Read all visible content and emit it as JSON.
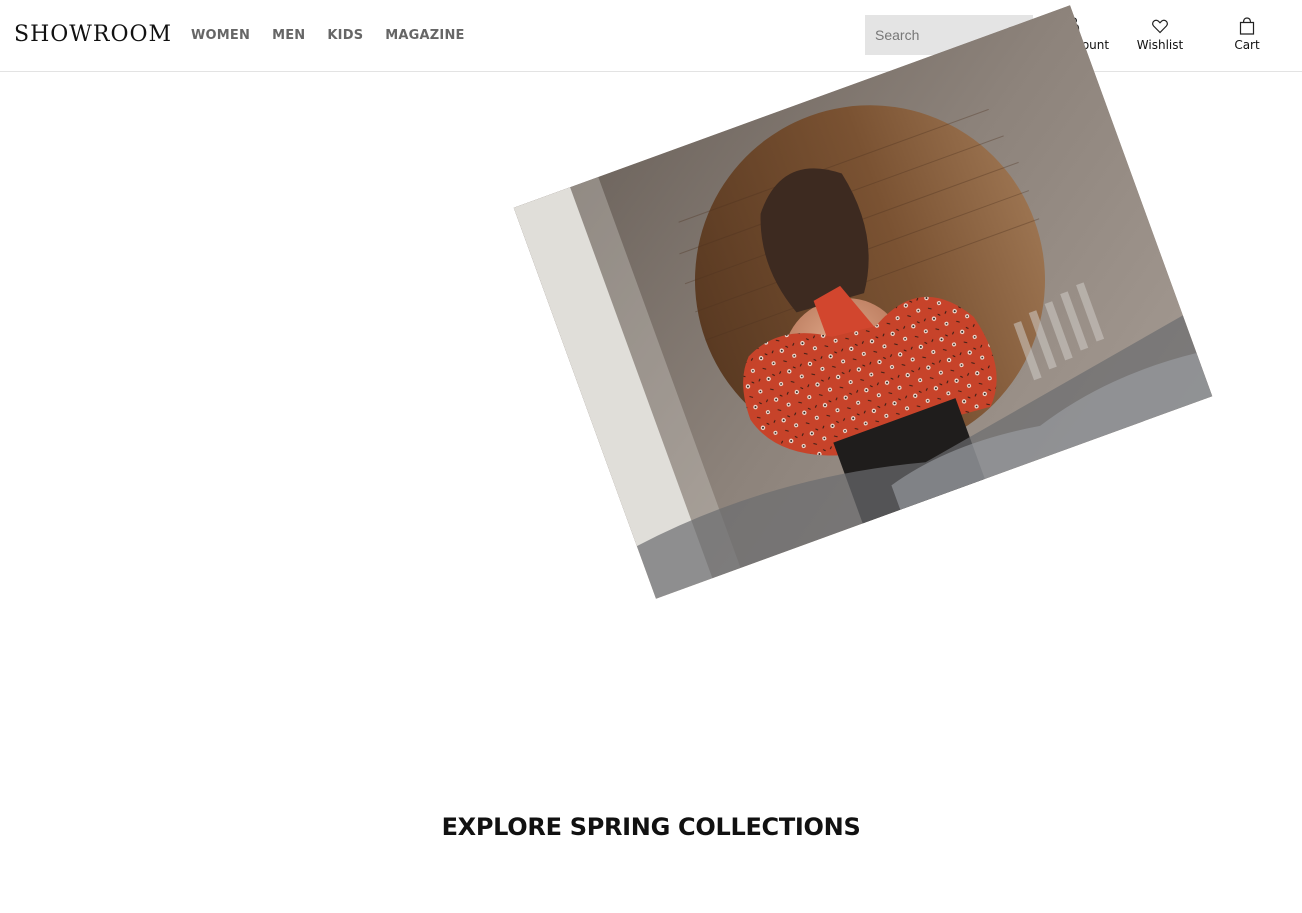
{
  "brand": {
    "logo_text": "SHOWROOM"
  },
  "nav": {
    "items": [
      {
        "label": "WOMEN"
      },
      {
        "label": "MEN"
      },
      {
        "label": "KIDS"
      },
      {
        "label": "MAGAZINE"
      }
    ]
  },
  "search": {
    "placeholder": "Search",
    "icon": "search-icon"
  },
  "utility": {
    "account": {
      "label": "My account",
      "icon": "person-icon"
    },
    "wishlist": {
      "label": "Wishlist",
      "icon": "heart-icon"
    },
    "cart": {
      "label": "Cart",
      "icon": "shopping-bag-icon"
    }
  },
  "main": {
    "section_title": "EXPLORE SPRING COLLECTIONS"
  },
  "colors": {
    "text": "#111111",
    "nav_text": "#666666",
    "search_bg": "#e4e4e4",
    "header_border": "#e3e3e3"
  }
}
